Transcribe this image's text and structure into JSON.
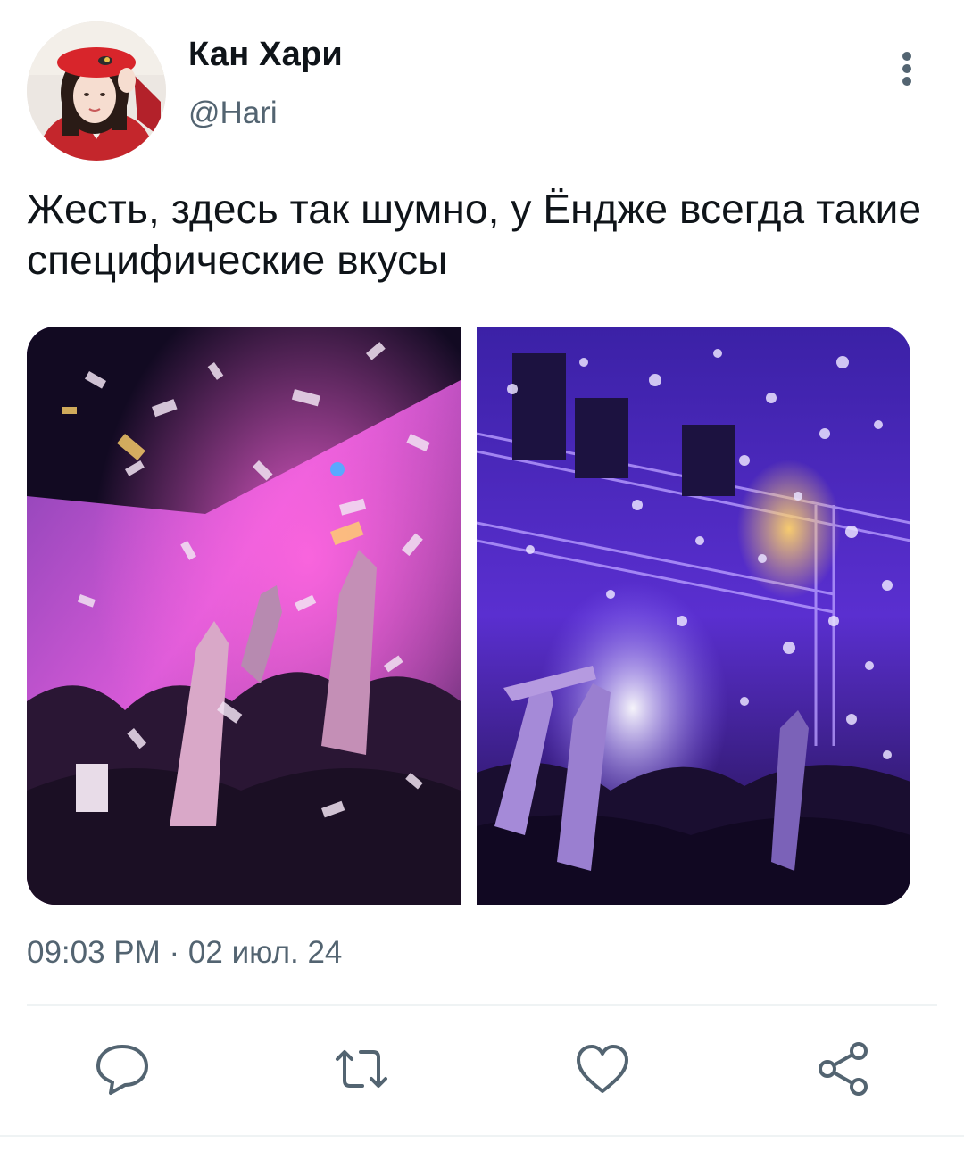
{
  "author": {
    "display_name": "Кан Хари",
    "handle": "@Hari"
  },
  "tweet": {
    "text": "Жесть, здесь так шумно, у Ёндже всегда такие специфические вкусы",
    "timestamp": "09:03 PM · 02 июл. 24"
  },
  "media": [
    {
      "description_icon": "photo",
      "theme": "pink-purple party confetti"
    },
    {
      "description_icon": "photo",
      "theme": "violet concert stage confetti"
    }
  ],
  "actions": [
    {
      "name": "reply",
      "icon": "speech-bubble-icon"
    },
    {
      "name": "retweet",
      "icon": "retweet-icon"
    },
    {
      "name": "like",
      "icon": "heart-icon"
    },
    {
      "name": "share",
      "icon": "share-icon"
    }
  ],
  "colors": {
    "text_primary": "#0f1419",
    "text_secondary": "#536471",
    "divider": "#eff3f4"
  }
}
